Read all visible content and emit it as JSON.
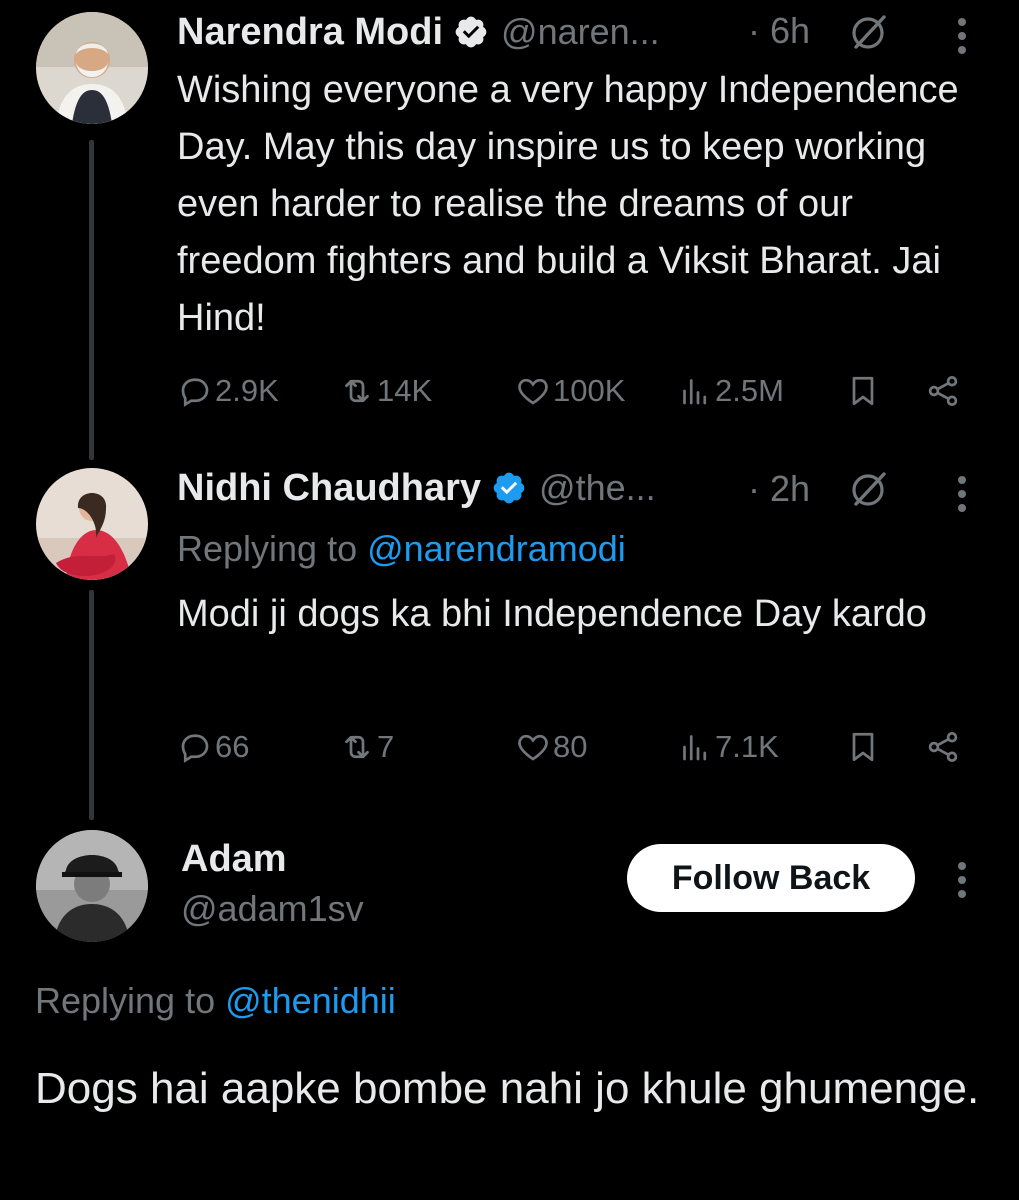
{
  "tweets": [
    {
      "name": "Narendra Modi",
      "handle": "@naren...",
      "time": "· 6h",
      "text": "Wishing everyone a very happy Independence Day. May this day inspire us to keep working even harder to realise the dreams of our freedom fighters and build a Viksit Bharat. Jai Hind!",
      "replies": "2.9K",
      "reposts": "14K",
      "likes": "100K",
      "views": "2.5M"
    },
    {
      "name": "Nidhi Chaudhary",
      "handle": "@the...",
      "time": "· 2h",
      "replying_prefix": "Replying to ",
      "replying_mention": "@narendramodi",
      "text": "Modi ji dogs ka bhi Independence Day kardo",
      "replies": "66",
      "reposts": "7",
      "likes": "80",
      "views": "7.1K"
    }
  ],
  "focused": {
    "name": "Adam",
    "handle": "@adam1sv",
    "follow_label": "Follow Back",
    "replying_prefix": "Replying to ",
    "replying_mention": "@thenidhii",
    "text": "Dogs hai aapke bombe nahi jo khule ghumenge."
  },
  "colors": {
    "background": "#000000",
    "text": "#e7e9ea",
    "muted": "#71767b",
    "link": "#1d9bf0",
    "verified": "#1d9bf0"
  }
}
